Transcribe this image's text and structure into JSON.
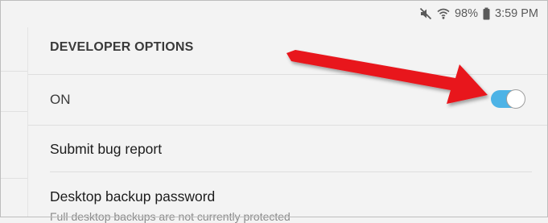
{
  "status_bar": {
    "battery_percent": "98%",
    "time": "3:59 PM",
    "icons": [
      "mute-icon",
      "wifi-icon",
      "battery-icon"
    ]
  },
  "settings": {
    "section_title": "DEVELOPER OPTIONS",
    "master_toggle": {
      "label": "ON",
      "state": true
    },
    "items": [
      {
        "title": "Submit bug report"
      },
      {
        "title": "Desktop backup password",
        "subtitle": "Full desktop backups are not currently protected"
      }
    ]
  },
  "colors": {
    "toggle_on": "#4db3e6",
    "annotation_arrow": "#e8141b",
    "background": "#f3f3f3"
  }
}
